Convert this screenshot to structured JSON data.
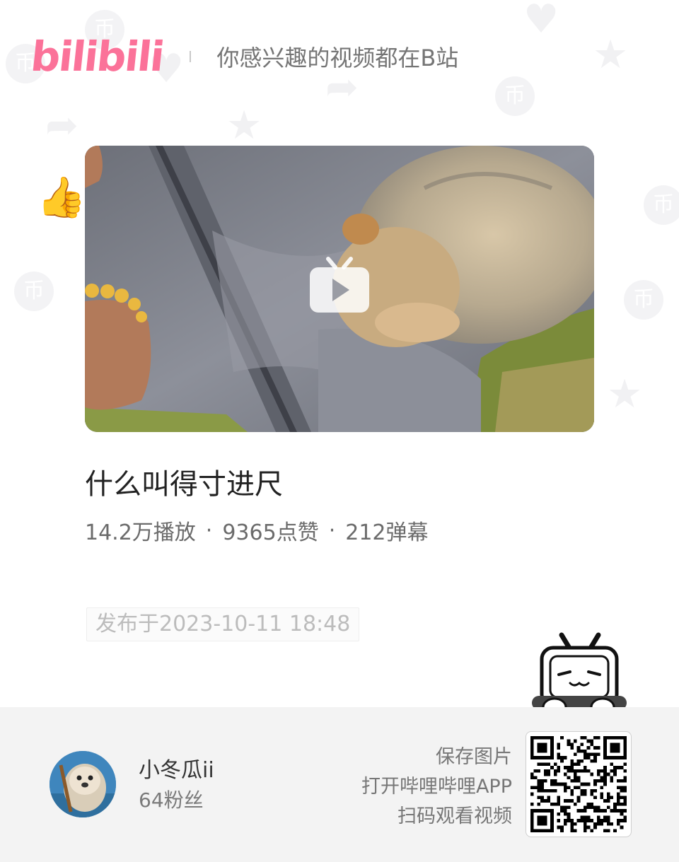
{
  "header": {
    "logo_text": "bilibili",
    "slogan": "你感兴趣的视频都在B站"
  },
  "video": {
    "title": "什么叫得寸进尺",
    "play_count": "14.2万播放",
    "like_count": "9365点赞",
    "danmaku_count": "212弹幕",
    "separator": "·",
    "publish_time": "发布于2023-10-11 18:48"
  },
  "author": {
    "name": "小冬瓜ii",
    "fans": "64粉丝"
  },
  "footer": {
    "tip_save": "保存图片",
    "tip_open": "打开哔哩哔哩APP",
    "tip_scan": "扫码观看视频"
  },
  "icons": {
    "play": "play-icon",
    "mascot": "bilibili-tv-mascot-icon",
    "qr": "qr-code"
  },
  "colors": {
    "brand_pink": "#fb7299",
    "footer_bg": "#f3f3f3",
    "text_dark": "#222222",
    "text_gray": "#6b6b6b"
  }
}
